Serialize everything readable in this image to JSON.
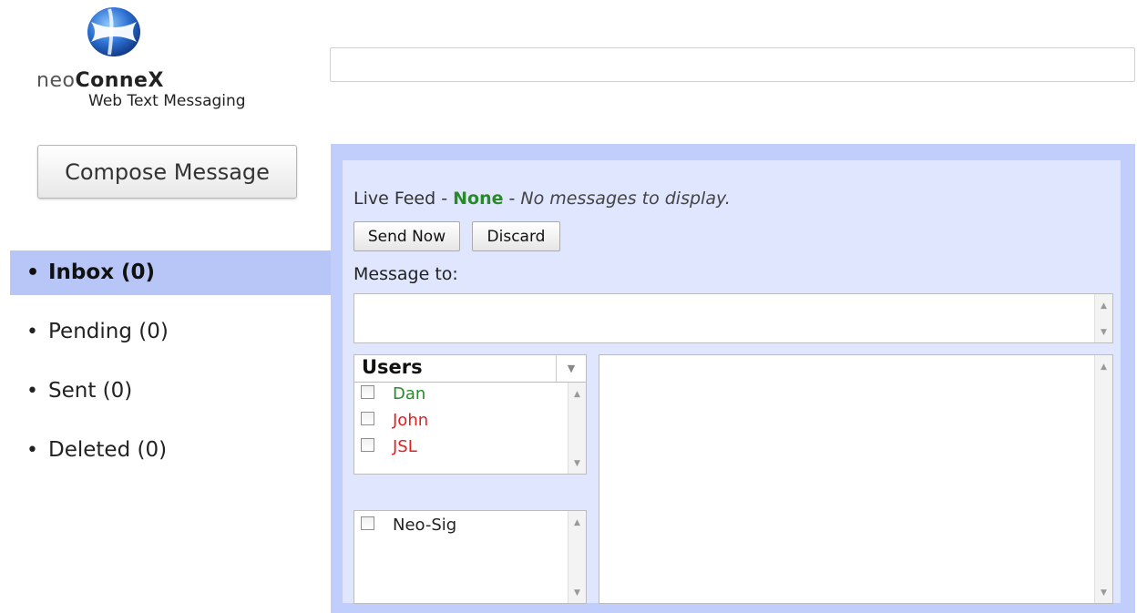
{
  "app": {
    "brand_prefix": "neo",
    "brand_main": "ConneX",
    "subtitle": "Web Text Messaging"
  },
  "top_field": {
    "value": ""
  },
  "compose": {
    "label": "Compose Message"
  },
  "nav": {
    "items": [
      {
        "label": "Inbox (0)",
        "active": true
      },
      {
        "label": "Pending (0)",
        "active": false
      },
      {
        "label": "Sent (0)",
        "active": false
      },
      {
        "label": "Deleted (0)",
        "active": false
      }
    ]
  },
  "feed": {
    "prefix": "Live Feed - ",
    "status": "None",
    "separator": " - ",
    "empty_text": "No messages to display.",
    "status_color": "#2a8a2a"
  },
  "actions": {
    "send_label": "Send Now",
    "discard_label": "Discard"
  },
  "message_to": {
    "label": "Message to:",
    "value": ""
  },
  "users": {
    "header": "Users",
    "items": [
      {
        "name": "Dan",
        "color": "#2a8a2a",
        "checked": false
      },
      {
        "name": "John",
        "color": "#d22222",
        "checked": false
      },
      {
        "name": "JSL",
        "color": "#d22222",
        "checked": false
      }
    ]
  },
  "groups": {
    "items": [
      {
        "name": "Neo-Sig",
        "checked": false
      }
    ]
  },
  "message_body": {
    "value": ""
  },
  "colors": {
    "panel_border": "#c1cdfa",
    "panel_fill": "#dfe6fd",
    "nav_active": "#b7c6f6"
  },
  "icons": {
    "logo": "globe-logo-icon",
    "dropdown": "chevron-down-icon",
    "scroll_up": "scroll-up-icon",
    "scroll_down": "scroll-down-icon"
  }
}
